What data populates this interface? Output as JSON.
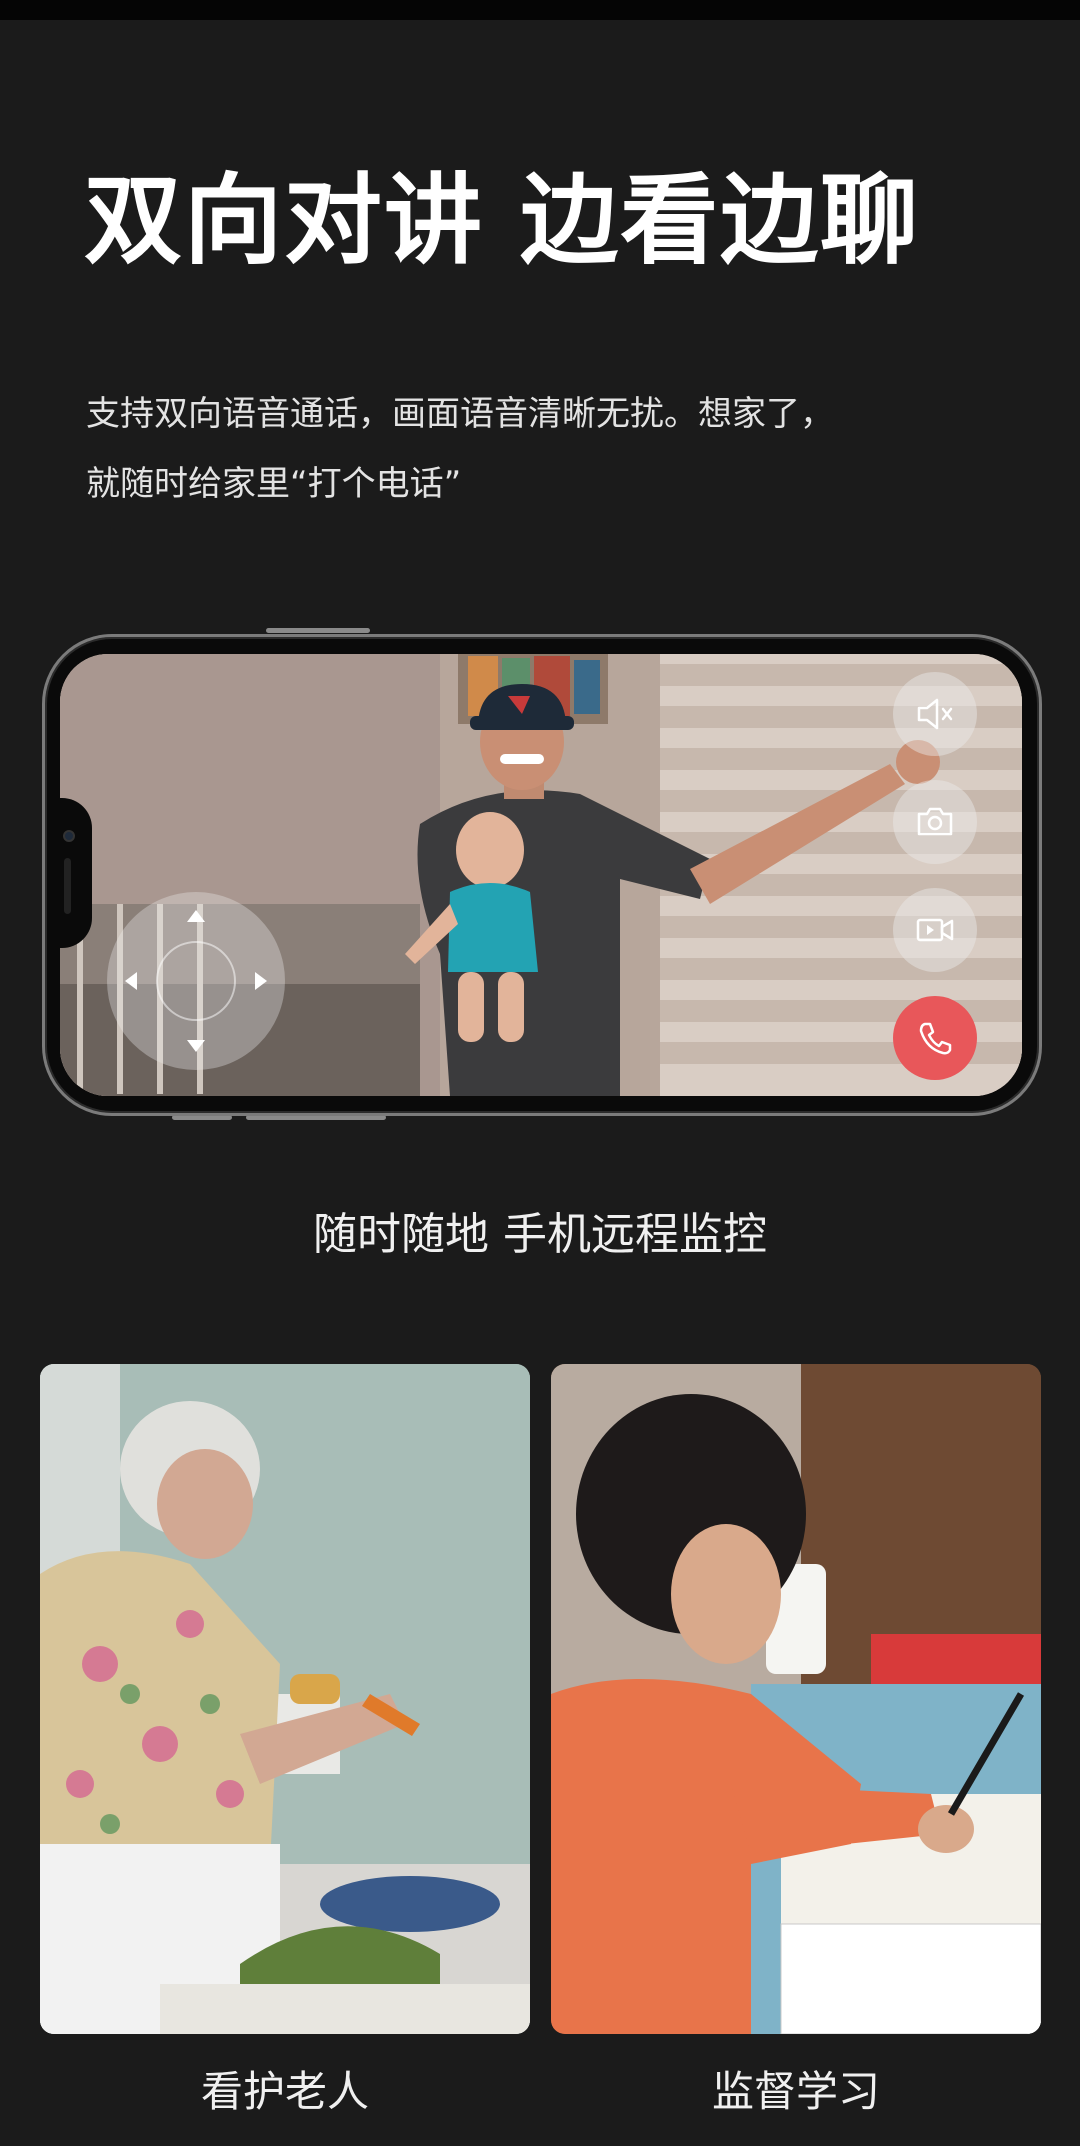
{
  "headline": "双向对讲 边看边聊",
  "description": {
    "line1": "支持双向语音通话，画面语音清晰无扰。想家了，",
    "line2": "就随时给家里“打个电话”"
  },
  "phone_controls": {
    "buttons": [
      {
        "name": "mute",
        "icon": "speaker-mute-icon"
      },
      {
        "name": "snapshot",
        "icon": "camera-icon"
      },
      {
        "name": "record",
        "icon": "video-record-icon"
      },
      {
        "name": "call",
        "icon": "phone-call-icon"
      }
    ],
    "call_button_color": "#e8575a",
    "dpad_icon": "direction-pad-icon"
  },
  "main_caption": "随时随地 手机远程监控",
  "features": [
    {
      "label": "看护老人"
    },
    {
      "label": "监督学习"
    }
  ]
}
